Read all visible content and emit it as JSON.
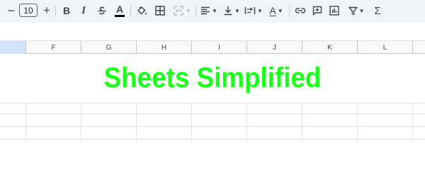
{
  "toolbar": {
    "decrease_font_symbol": "−",
    "font_size": "10",
    "increase_font_symbol": "+",
    "bold_label": "B",
    "italic_label": "I",
    "text_color_label": "A",
    "text_rotation_label": "A",
    "sum_symbol": "Σ",
    "text_color_swatch": "#000000"
  },
  "grid": {
    "columns": [
      "F",
      "G",
      "H",
      "I",
      "J",
      "K",
      "L"
    ],
    "banner_text": "Sheets Simplified",
    "banner_color": "#19ff19"
  }
}
